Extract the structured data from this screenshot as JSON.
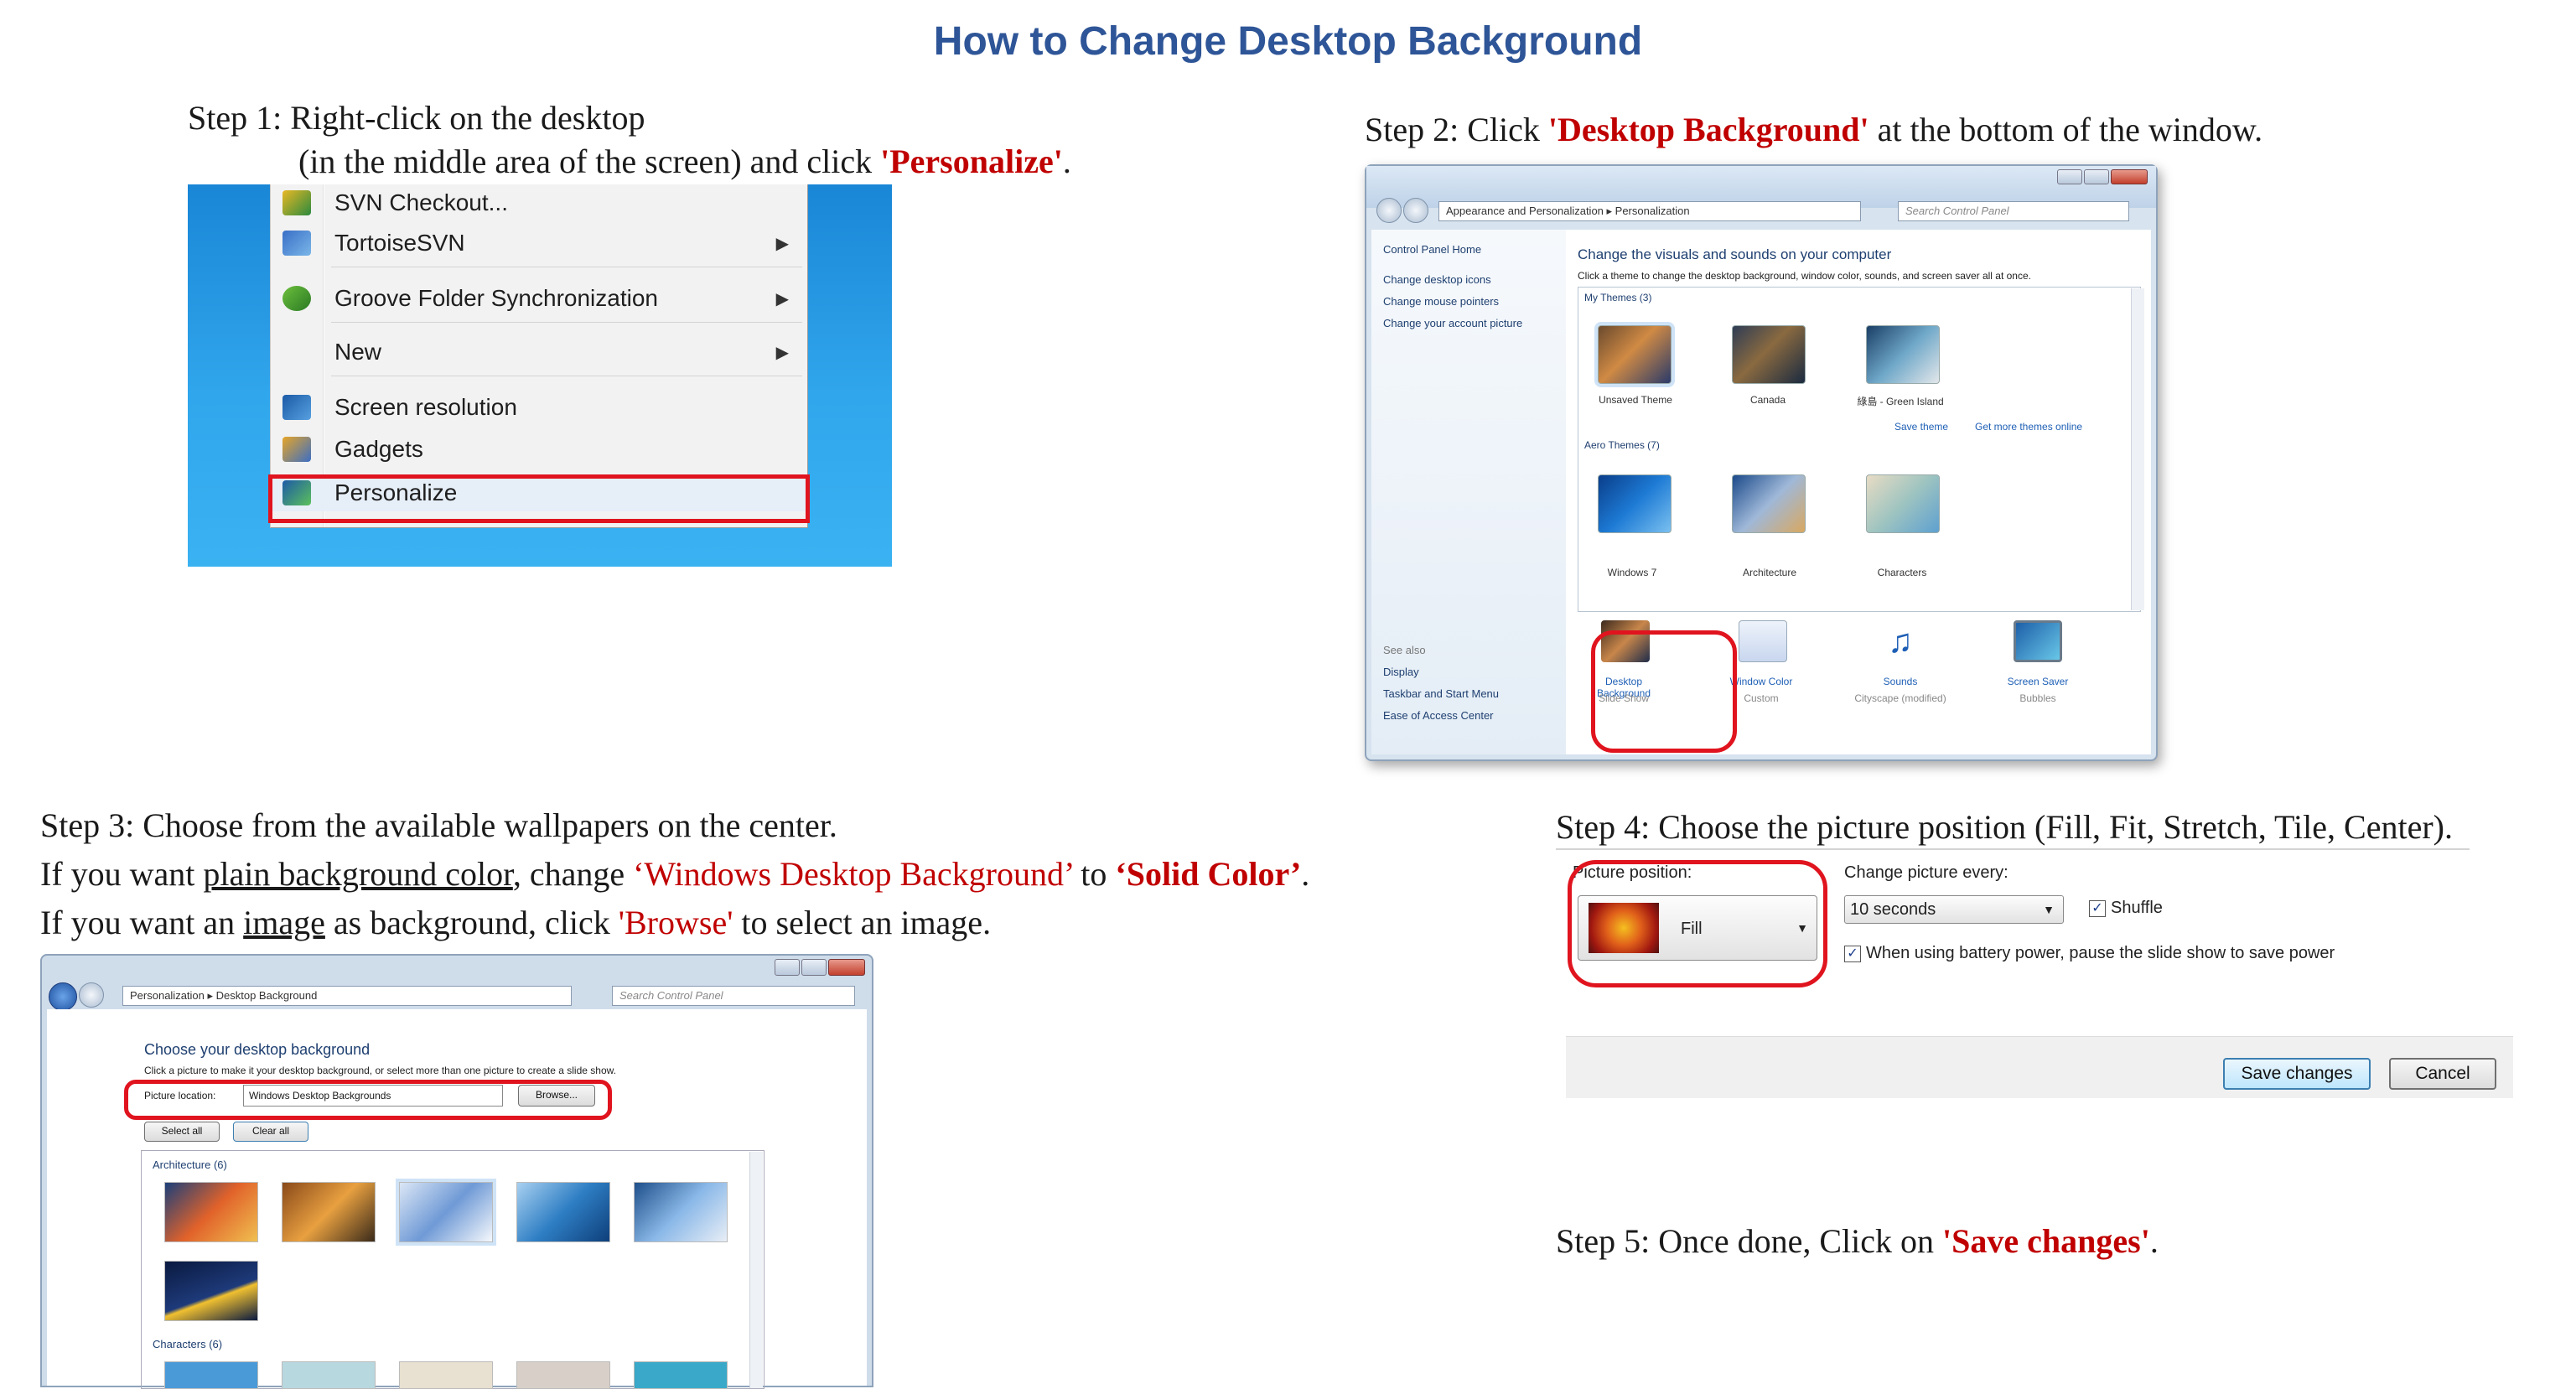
{
  "title": "How to Change Desktop Background",
  "step1": {
    "line1": "Step 1: Right-click on the desktop",
    "line2_pre": "(in the middle area of the screen) and click ",
    "line2_emph": "'Personalize'",
    "line2_post": ".",
    "menu": [
      "SVN Checkout...",
      "TortoiseSVN",
      "Groove Folder Synchronization",
      "New",
      "Screen resolution",
      "Gadgets",
      "Personalize"
    ]
  },
  "step2": {
    "pre": "Step 2: Click ",
    "emph": "'Desktop Background'",
    "post": " at the bottom of the window.",
    "breadcrumb": "Appearance and Personalization  ▸  Personalization",
    "search": "Search Control Panel",
    "left_links": [
      "Control Panel Home",
      "Change desktop icons",
      "Change mouse pointers",
      "Change your account picture"
    ],
    "see_also": "See also",
    "see_also_links": [
      "Display",
      "Taskbar and Start Menu",
      "Ease of Access Center"
    ],
    "heading": "Change the visuals and sounds on your computer",
    "subheading": "Click a theme to change the desktop background, window color, sounds, and screen saver all at once.",
    "my_themes": "My Themes (3)",
    "themes_mine": [
      "Unsaved Theme",
      "Canada",
      "綠島 - Green Island"
    ],
    "save_theme": "Save theme",
    "get_more": "Get more themes online",
    "aero_themes": "Aero Themes (7)",
    "themes_aero": [
      "Windows 7",
      "Architecture",
      "Characters"
    ],
    "bottom": [
      {
        "label": "Desktop Background",
        "sub": "Slide Show"
      },
      {
        "label": "Window Color",
        "sub": "Custom"
      },
      {
        "label": "Sounds",
        "sub": "Cityscape (modified)"
      },
      {
        "label": "Screen Saver",
        "sub": "Bubbles"
      }
    ]
  },
  "step3": {
    "line1": "Step 3: Choose from the available wallpapers on the center.",
    "line2_a": "If you want ",
    "line2_u": "plain background color",
    "line2_b": ", change ",
    "line2_red": "‘Windows Desktop Background’",
    "line2_c": " to ",
    "line2_redb": "‘Solid Color’",
    "line2_d": ".",
    "line3_a": "If you want an ",
    "line3_u": "image",
    "line3_b": " as background, click ",
    "line3_red": "'Browse'",
    "line3_c": " to select an image.",
    "breadcrumb": "Personalization  ▸  Desktop Background",
    "search": "Search Control Panel",
    "heading": "Choose your desktop background",
    "sub": "Click a picture to make it your desktop background, or select more than one picture to create a slide show.",
    "loc_label": "Picture location:",
    "loc_value": "Windows Desktop Backgrounds",
    "browse": "Browse...",
    "select_all": "Select all",
    "clear_all": "Clear all",
    "group1": "Architecture (6)",
    "group2": "Characters (6)"
  },
  "step4": {
    "text": "Step 4: Choose the picture position (Fill, Fit, Stretch, Tile, Center).",
    "pos_label": "Picture position:",
    "pos_value": "Fill",
    "change_label": "Change picture every:",
    "change_value": "10 seconds",
    "shuffle": "Shuffle",
    "battery": "When using battery power, pause the slide show to save power",
    "save": "Save changes",
    "cancel": "Cancel"
  },
  "step5": {
    "pre": "Step 5: Once done, Click on ",
    "emph": "'Save changes'",
    "post": "."
  },
  "colors": {
    "title": "#2e5597",
    "emphasis": "#c00000",
    "highlight": "#e0141e"
  }
}
